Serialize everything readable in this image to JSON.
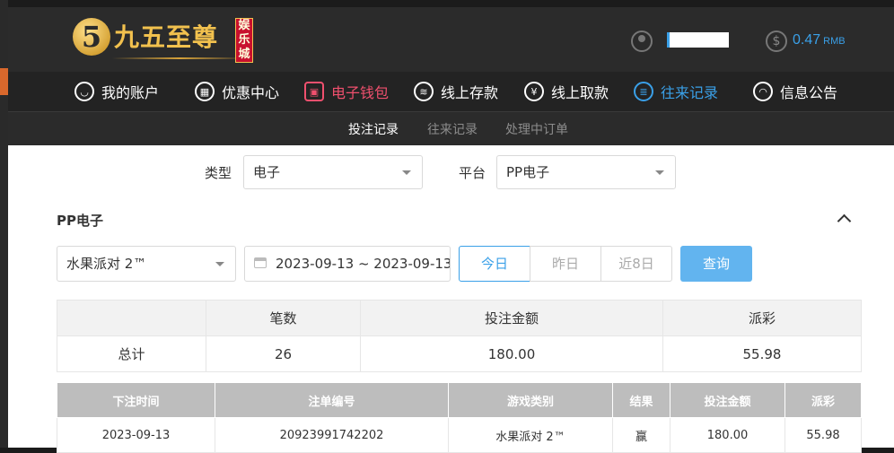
{
  "brand": {
    "logo_numeral": "5",
    "name": "九五至尊",
    "badge": "娱乐城"
  },
  "account": {
    "balance": "0.47",
    "currency": "RMB"
  },
  "nav": [
    {
      "label": "我的账户",
      "icon": "user-icon"
    },
    {
      "label": "优惠中心",
      "icon": "gift-icon"
    },
    {
      "label": "电子钱包",
      "icon": "wallet-icon"
    },
    {
      "label": "线上存款",
      "icon": "deposit-icon"
    },
    {
      "label": "线上取款",
      "icon": "withdraw-icon"
    },
    {
      "label": "往来记录",
      "icon": "records-icon"
    },
    {
      "label": "信息公告",
      "icon": "bell-icon"
    }
  ],
  "subtabs": [
    "投注记录",
    "往来记录",
    "处理中订单"
  ],
  "filters": {
    "type_label": "类型",
    "type_value": "电子",
    "platform_label": "平台",
    "platform_value": "PP电子"
  },
  "section": {
    "title": "PP电子",
    "game_value": "水果派对 2™",
    "date_range": "2023-09-13 ~ 2023-09-13",
    "today": "今日",
    "yesterday": "昨日",
    "last8": "近8日",
    "query": "查询"
  },
  "summary": {
    "headers": [
      "",
      "笔数",
      "投注金额",
      "派彩"
    ],
    "row": [
      "总计",
      "26",
      "180.00",
      "55.98"
    ]
  },
  "detail": {
    "headers": [
      "下注时间",
      "注单编号",
      "游戏类别",
      "结果",
      "投注金额",
      "派彩"
    ],
    "rows": [
      [
        "2023-09-13",
        "20923991742202",
        "水果派对 2™",
        "赢",
        "180.00",
        "55.98"
      ]
    ]
  },
  "colors": {
    "accent_blue": "#3aa0e8",
    "accent_red": "#f0506e",
    "gold": "#f2c14e"
  }
}
